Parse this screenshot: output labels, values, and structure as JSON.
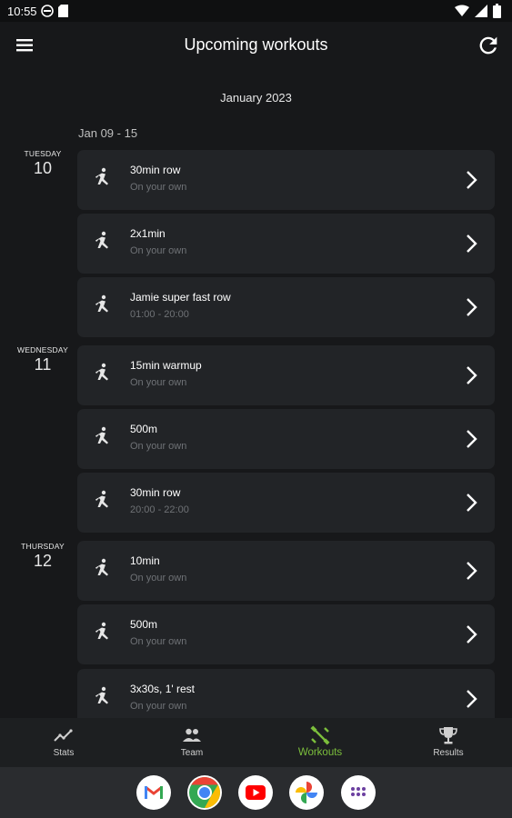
{
  "status_bar": {
    "time": "10:55"
  },
  "app_bar": {
    "title": "Upcoming workouts"
  },
  "schedule": {
    "month": "January 2023",
    "week": "Jan 09 - 15",
    "days": [
      {
        "name": "TUESDAY",
        "number": "10"
      },
      {
        "name": "WEDNESDAY",
        "number": "11"
      },
      {
        "name": "THURSDAY",
        "number": "12"
      }
    ],
    "workouts": [
      {
        "title": "30min row",
        "subtitle": "On your own"
      },
      {
        "title": "2x1min",
        "subtitle": "On your own"
      },
      {
        "title": "Jamie super fast row",
        "subtitle": "01:00 - 20:00"
      },
      {
        "title": "15min warmup",
        "subtitle": "On your own"
      },
      {
        "title": "500m",
        "subtitle": "On your own"
      },
      {
        "title": "30min row",
        "subtitle": "20:00 - 22:00"
      },
      {
        "title": "10min",
        "subtitle": "On your own"
      },
      {
        "title": "500m",
        "subtitle": "On your own"
      },
      {
        "title": "3x30s, 1' rest",
        "subtitle": "On your own"
      }
    ]
  },
  "bottom_nav": {
    "items": [
      {
        "label": "Stats",
        "icon": "stats-icon"
      },
      {
        "label": "Team",
        "icon": "team-icon"
      },
      {
        "label": "Workouts",
        "icon": "workouts-icon",
        "active": true
      },
      {
        "label": "Results",
        "icon": "trophy-icon"
      }
    ],
    "active_color": "#7cbf3c"
  },
  "dock": {
    "apps": [
      "Gmail",
      "Chrome",
      "YouTube",
      "Photos",
      "App drawer"
    ]
  },
  "colors": {
    "background": "#17181a",
    "card": "#222427",
    "subtitle": "#6f7276",
    "accent": "#7cbf3c"
  }
}
